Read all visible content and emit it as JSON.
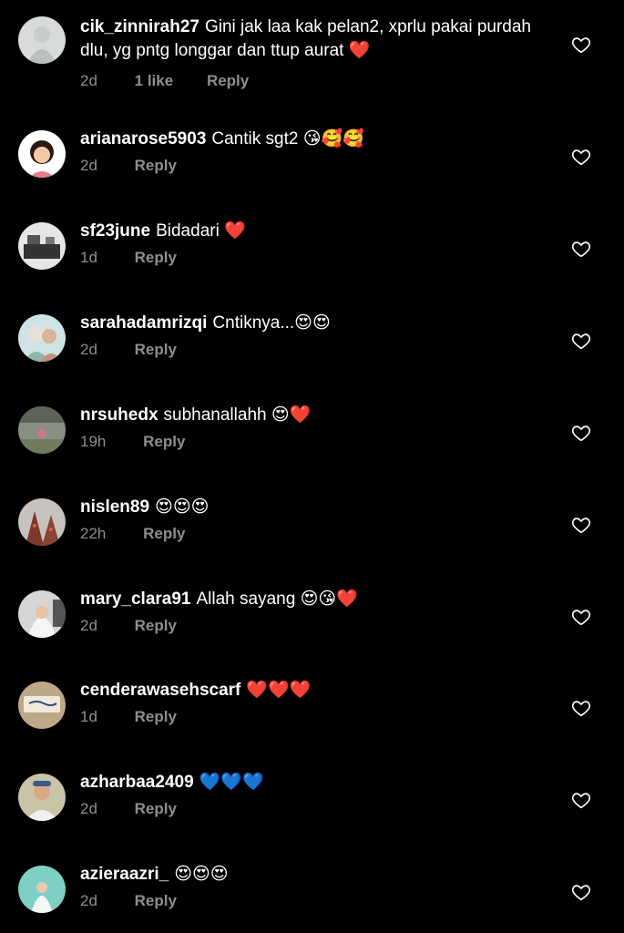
{
  "comments": [
    {
      "username": "cik_zinnirah27",
      "text": "Gini jak laa kak pelan2, xprlu pakai purdah dlu, yg pntg longgar dan ttup aurat ❤️",
      "time": "2d",
      "likes": "1 like",
      "reply": "Reply"
    },
    {
      "username": "arianarose5903",
      "text": "Cantik sgt2 😘🥰🥰",
      "time": "2d",
      "reply": "Reply"
    },
    {
      "username": "sf23june",
      "text": "Bidadari ❤️",
      "time": "1d",
      "reply": "Reply"
    },
    {
      "username": "sarahadamrizqi",
      "text": "Cntiknya...😍😍",
      "time": "2d",
      "reply": "Reply"
    },
    {
      "username": "nrsuhedx",
      "text": "subhanallahh 😍❤️",
      "time": "19h",
      "reply": "Reply"
    },
    {
      "username": "nislen89",
      "text": "😍😍😍",
      "time": "22h",
      "reply": "Reply"
    },
    {
      "username": "mary_clara91",
      "text": "Allah sayang 😍😘❤️",
      "time": "2d",
      "reply": "Reply"
    },
    {
      "username": "cenderawasehscarf",
      "text": "❤️❤️❤️",
      "time": "1d",
      "reply": "Reply"
    },
    {
      "username": "azharbaa2409",
      "text": "💙💙💙",
      "time": "2d",
      "reply": "Reply"
    },
    {
      "username": "azieraazri_",
      "text": "😍😍😍",
      "time": "2d",
      "reply": "Reply"
    }
  ],
  "colors": {
    "background": "#000000",
    "text": "#ffffff",
    "meta": "#8e8e8e"
  }
}
